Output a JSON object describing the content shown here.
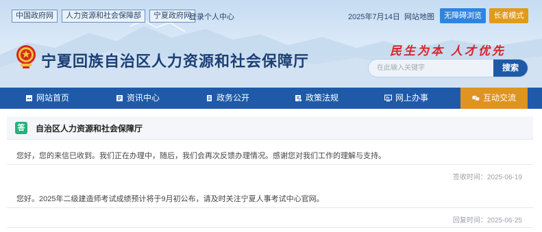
{
  "top_links": [
    "中国政府网",
    "人力资源和社会保障部",
    "宁夏政府网"
  ],
  "login_link": "登录个人中心",
  "date": "2025年7月14日",
  "sitemap": "网站地图",
  "accessible_button": "无障碍浏览",
  "elder_button": "长者模式",
  "site_title": "宁夏回族自治区人力资源和社会保障厅",
  "slogan": "民生为本 人才优先",
  "search": {
    "placeholder": "在此输入关键字",
    "button": "搜索"
  },
  "nav": [
    {
      "label": "网站首页",
      "icon": "home-icon"
    },
    {
      "label": "资讯中心",
      "icon": "news-icon"
    },
    {
      "label": "政务公开",
      "icon": "document-icon"
    },
    {
      "label": "政策法规",
      "icon": "policy-icon"
    },
    {
      "label": "网上办事",
      "icon": "monitor-icon"
    },
    {
      "label": "互动交流",
      "icon": "chat-icon",
      "active": true
    }
  ],
  "colors": {
    "brand_blue": "#1e5aa8",
    "accent_orange": "#df9321",
    "badge_green": "#27b07c",
    "slogan_red": "#d4252a"
  },
  "reply": {
    "badge": "答",
    "org": "自治区人力资源和社会保障厅",
    "messages": [
      {
        "text": "您好，您的来信已收到。我们正在办理中，随后，我们会再次反馈办理情况。感谢您对我们工作的理解与支持。",
        "meta": "签收时间：2025-06-19"
      },
      {
        "text": "您好。2025年二级建造师考试成绩预计将于9月初公布，请及时关注宁夏人事考试中心官网。",
        "meta": "回复时间：2025-06-25"
      }
    ]
  }
}
